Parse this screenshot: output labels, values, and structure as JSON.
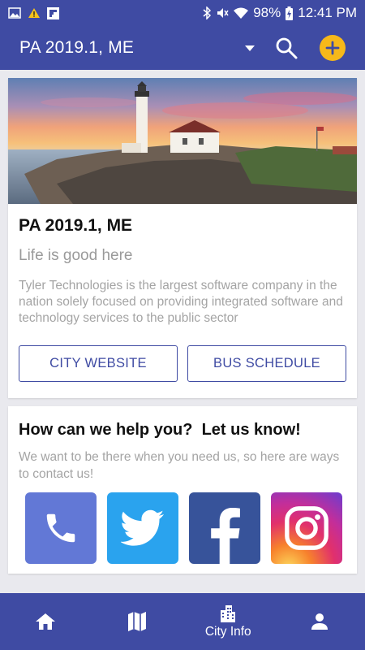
{
  "status_bar": {
    "battery": "98%",
    "time": "12:41 PM"
  },
  "app_bar": {
    "title": "PA 2019.1, ME"
  },
  "hero_card": {
    "title": "PA 2019.1, ME",
    "subtitle": "Life is good here",
    "description": "Tyler Technologies is the largest software company in the nation solely focused on providing integrated software and technology services to the public sector",
    "buttons": {
      "city_website": "CITY WEBSITE",
      "bus_schedule": "BUS SCHEDULE"
    }
  },
  "help_card": {
    "title": "How can we help you?  Let us know!",
    "description": "We want to be there when you need us, so here are ways to contact us!",
    "contacts": [
      "phone",
      "twitter",
      "facebook",
      "instagram"
    ]
  },
  "bottom_nav": {
    "items": [
      {
        "icon": "home-icon",
        "label": ""
      },
      {
        "icon": "map-icon",
        "label": ""
      },
      {
        "icon": "city-icon",
        "label": "City Info"
      },
      {
        "icon": "person-icon",
        "label": ""
      }
    ]
  },
  "colors": {
    "primary": "#3f4ba3",
    "accent": "#f6b81a",
    "phone": "#6278d6",
    "twitter": "#2aa3ee",
    "facebook": "#37539a"
  }
}
